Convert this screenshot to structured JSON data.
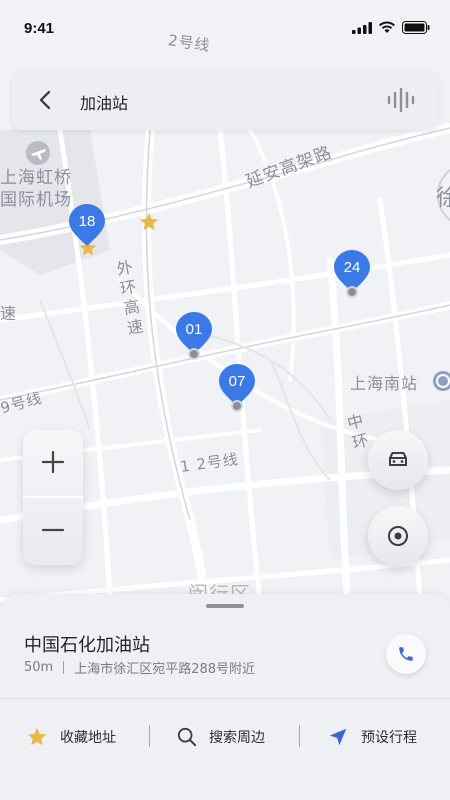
{
  "status_bar": {
    "time": "9:41"
  },
  "search": {
    "title": "加油站",
    "back_icon": "chevron-left-icon",
    "voice_icon": "voice-wave-icon"
  },
  "map": {
    "labels": {
      "metro_line_2": "2号线",
      "airport": "上海虹桥\n国际机场",
      "yanan_elevated": "延安高架路",
      "xu": "徐",
      "outer_ring": "外\n环\n高\n速",
      "su": "速",
      "line_9": "9号线",
      "south_station": "上海南站",
      "middle_ring": "中\n环",
      "line_12": "1 2号线",
      "minhang": "闵行区"
    },
    "markers": [
      {
        "number": "18"
      },
      {
        "number": "24"
      },
      {
        "number": "01"
      },
      {
        "number": "07"
      }
    ]
  },
  "controls": {
    "zoom_in_icon": "plus-icon",
    "zoom_out_icon": "minus-icon",
    "car_icon": "car-icon",
    "locate_icon": "locate-icon"
  },
  "station": {
    "name": "中国石化加油站",
    "distance": "50m",
    "address": "上海市徐汇区宛平路288号附近"
  },
  "actions": {
    "favorite": "收藏地址",
    "search_nearby": "搜索周边",
    "plan_trip": "预设行程"
  },
  "colors": {
    "marker_blue": "#3b7ae6",
    "star_gold": "#e8b84a",
    "nav_blue": "#3a66d6"
  }
}
